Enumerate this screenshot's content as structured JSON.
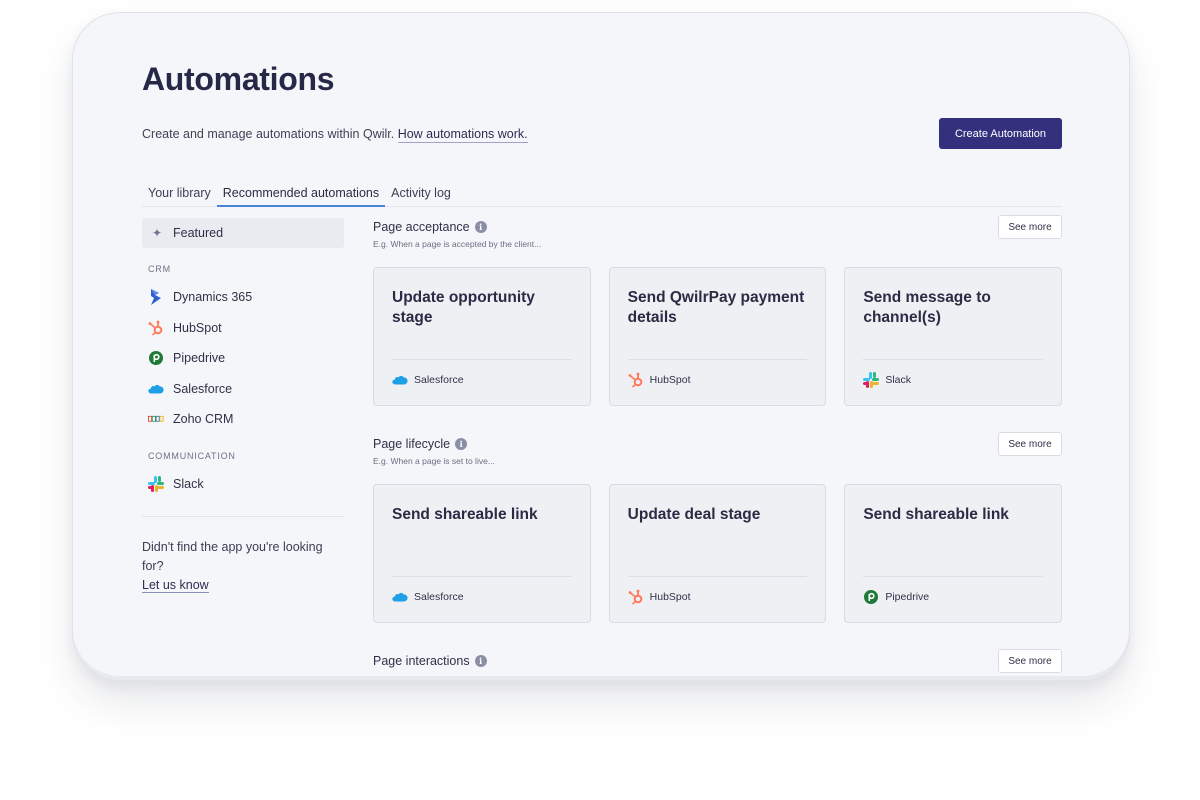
{
  "header": {
    "title": "Automations",
    "subtitle": "Create and manage automations within Qwilr.",
    "subtitle_link": "How automations work.",
    "create_button": "Create Automation"
  },
  "tabs": [
    {
      "label": "Your library",
      "active": false
    },
    {
      "label": "Recommended automations",
      "active": true
    },
    {
      "label": "Activity log",
      "active": false
    }
  ],
  "sidebar": {
    "featured": "Featured",
    "crm_heading": "CRM",
    "crm_items": [
      "Dynamics 365",
      "HubSpot",
      "Pipedrive",
      "Salesforce",
      "Zoho CRM"
    ],
    "communication_heading": "COMMUNICATION",
    "communication_items": [
      "Slack"
    ],
    "help_text": "Didn't find the app you're looking for?",
    "help_link": "Let us know"
  },
  "sections": [
    {
      "title": "Page acceptance",
      "description": "E.g. When a page is accepted by the client...",
      "see_more": "See more",
      "cards": [
        {
          "title": "Update opportunity stage",
          "app": "Salesforce"
        },
        {
          "title": "Send QwilrPay payment details",
          "app": "HubSpot"
        },
        {
          "title": "Send message to channel(s)",
          "app": "Slack"
        }
      ]
    },
    {
      "title": "Page lifecycle",
      "description": "E.g. When a page is set to live...",
      "see_more": "See more",
      "cards": [
        {
          "title": "Send shareable link",
          "app": "Salesforce"
        },
        {
          "title": "Update deal stage",
          "app": "HubSpot"
        },
        {
          "title": "Send shareable link",
          "app": "Pipedrive"
        }
      ]
    },
    {
      "title": "Page interactions",
      "see_more": "See more"
    }
  ],
  "colors": {
    "primary_button": "#33307d",
    "active_tab_underline": "#4a84d6",
    "card_background": "#eef0f4"
  },
  "icons": {
    "featured": "sparkle-icon",
    "dynamics": "dynamics-365-logo",
    "hubspot": "hubspot-logo",
    "pipedrive": "pipedrive-logo",
    "salesforce": "salesforce-logo",
    "zoho": "zoho-crm-logo",
    "slack": "slack-logo",
    "info": "info-icon"
  }
}
